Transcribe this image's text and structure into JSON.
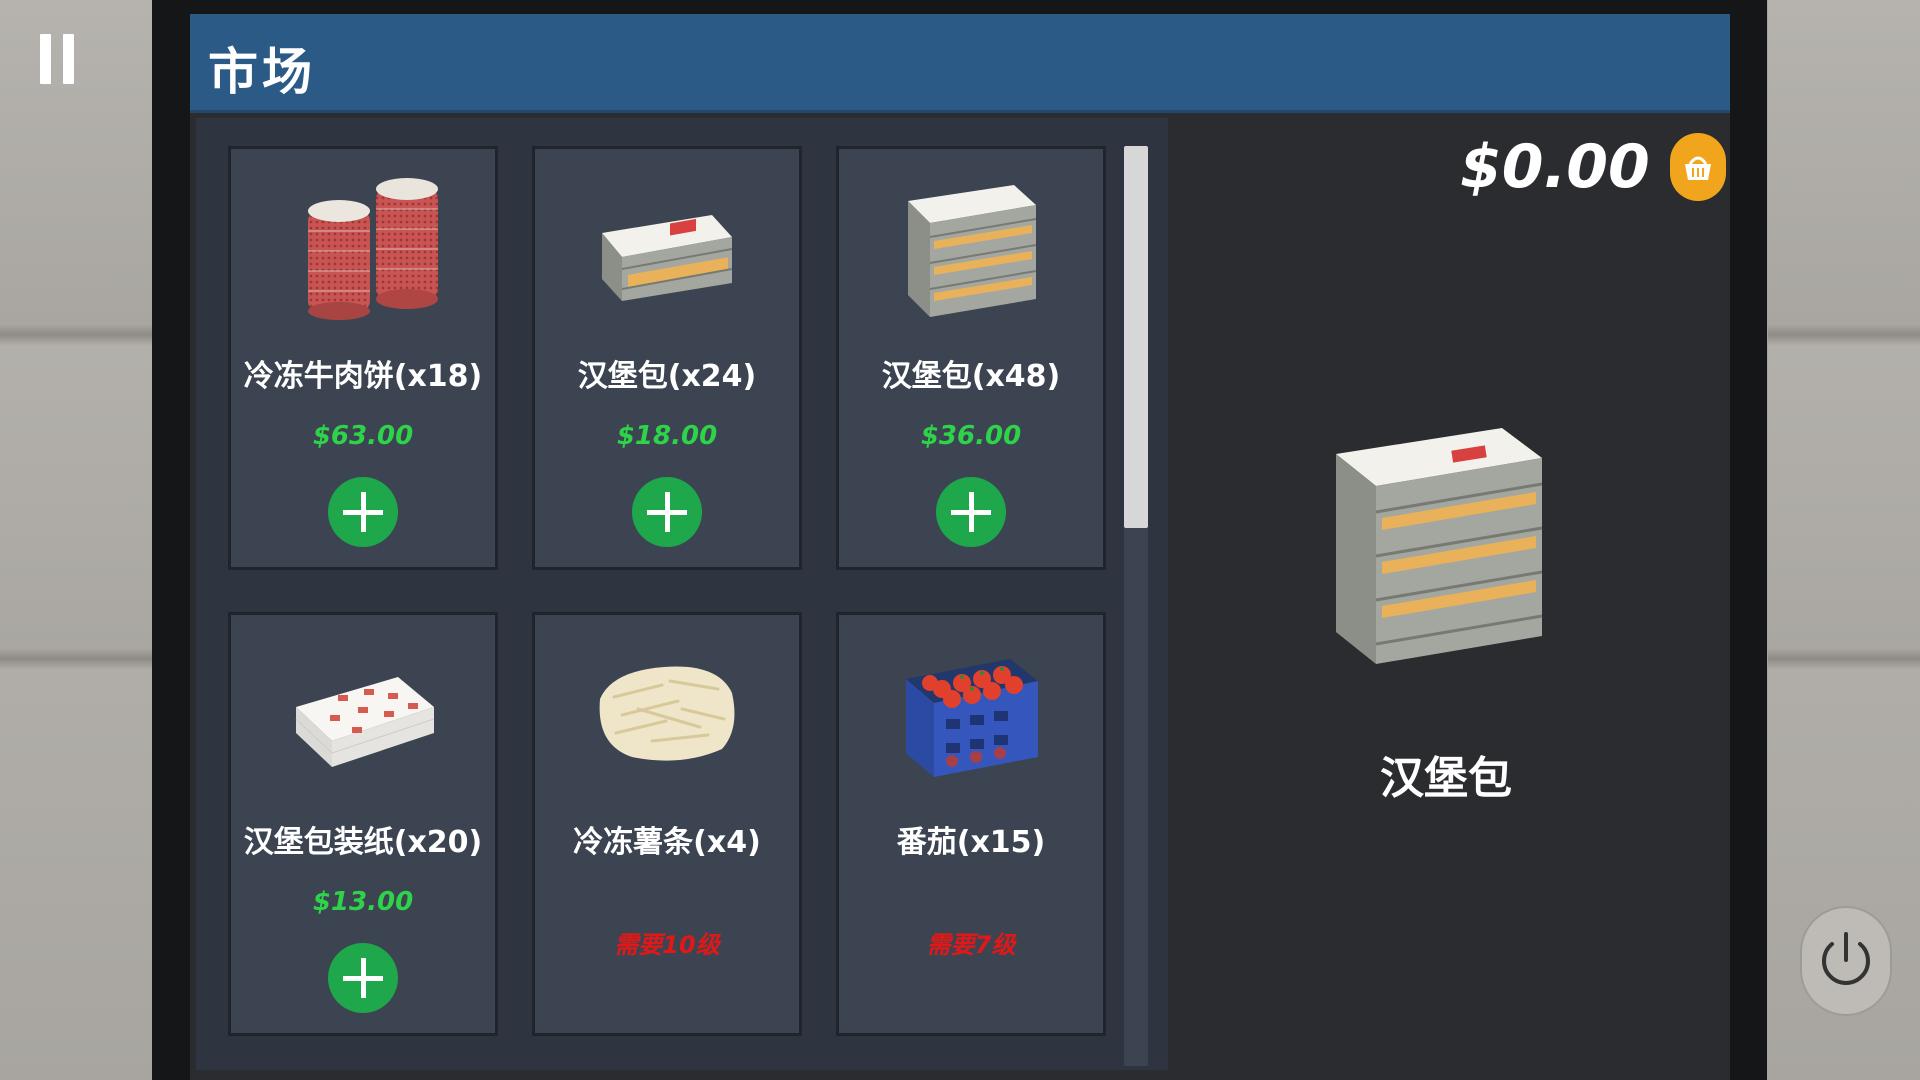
{
  "hud": {
    "pause_icon": "pause-icon"
  },
  "market": {
    "title": "市场",
    "balance": "$0.00",
    "cart_icon": "basket-icon",
    "items": [
      {
        "name": "冷冻牛肉饼(x18)",
        "price": "$63.00",
        "icon": "beef-patty-stack-icon"
      },
      {
        "name": "汉堡包(x24)",
        "price": "$18.00",
        "icon": "bun-crate-small-icon"
      },
      {
        "name": "汉堡包(x48)",
        "price": "$36.00",
        "icon": "bun-crate-large-icon"
      },
      {
        "name": "汉堡包装纸(x20)",
        "price": "$13.00",
        "icon": "wrapping-paper-icon"
      },
      {
        "name": "冷冻薯条(x4)",
        "requirement": "需要10级",
        "icon": "fries-bag-icon"
      },
      {
        "name": "番茄(x15)",
        "requirement": "需要7级",
        "icon": "tomato-crate-icon"
      }
    ],
    "preview": {
      "name": "汉堡包",
      "icon": "bun-crate-large-icon"
    }
  },
  "power_icon": "power-icon",
  "colors": {
    "header": "#2c5a87",
    "price": "#2ed34a",
    "locked": "#e11818",
    "add_button": "#1fa74b",
    "basket": "#f1a51c"
  }
}
